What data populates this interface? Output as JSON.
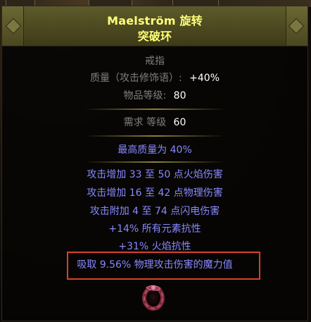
{
  "tooltip": {
    "item_name": "Maelström 旋转",
    "item_base": "突破环",
    "item_class": "戒指",
    "quality_label": "质量（攻击修饰语）:",
    "quality_value": "+40%",
    "item_level_label": "物品等级:",
    "item_level_value": "80",
    "requirement_label": "需求 等级",
    "requirement_value": "60",
    "enchant": "最高质量为 40%",
    "mods": [
      "攻击增加 33 至 50 点火焰伤害",
      "攻击增加 16 至 42 点物理伤害",
      "攻击附加 4 至 74 点闪电伤害",
      "+14% 所有元素抗性",
      "+31% 火焰抗性",
      "吸取 9.56% 物理攻击伤害的魔力值"
    ],
    "ring_icon": "ring-icon"
  },
  "colors": {
    "unique_name": "#ffff77",
    "label_grey": "#7f7f7f",
    "value_white": "#ffffff",
    "magic_blue": "#8888ff",
    "highlight_red": "#d8402c"
  }
}
